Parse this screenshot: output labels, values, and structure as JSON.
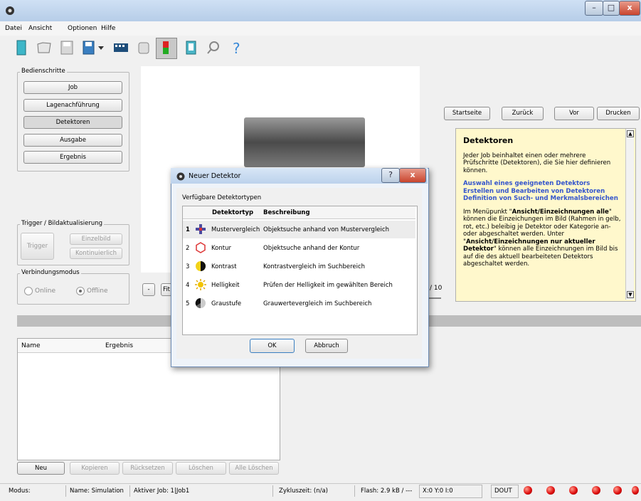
{
  "window": {
    "minimize": "–",
    "maximize": "□",
    "close": "x"
  },
  "menu": [
    "Datei",
    "Ansicht",
    "Optionen",
    "Hilfe"
  ],
  "steps": {
    "title": "Bedienschritte",
    "buttons": [
      "Job",
      "Lagenachführung",
      "Detektoren",
      "Ausgabe",
      "Ergebnis"
    ]
  },
  "trigger": {
    "title": "Trigger / Bildaktualisierung",
    "trigger_label": "Trigger",
    "single_label": "Einzelbild",
    "continuous_label": "Kontinuierlich"
  },
  "connection": {
    "title": "Verbindungsmodus",
    "online": "Online",
    "offline": "Offline"
  },
  "image_controls": {
    "minus": "-",
    "fit": "Fit",
    "page": "/ 10"
  },
  "results": {
    "col_name": "Name",
    "col_result": "Ergebnis",
    "buttons": [
      "Neu",
      "Kopieren",
      "Rücksetzen",
      "Löschen",
      "Alle Löschen"
    ]
  },
  "nav": [
    "Startseite",
    "Zurück",
    "Vor",
    "Drucken"
  ],
  "help": {
    "title": "Detektoren",
    "intro": "Jeder Job beinhaltet einen oder mehrere Prüfschritte (Detektoren), die Sie hier definieren können.",
    "links": [
      "Auswahl eines geeigneten Detektors",
      "Erstellen und Bearbeiten von Detektoren",
      "Definition von Such- und Merkmalsbereichen"
    ],
    "p1_a": "Im Menüpunkt \"",
    "p1_b": "Ansicht/Einzeichnungen alle",
    "p1_c": "\" können die Einzeichungen im Bild (Rahmen in gelb, rot, etc.) beleibig je Detektor oder Kategorie an- oder abgeschaltet werden. Unter \"",
    "p1_d": "Ansicht/Einzeichnungen nur aktueller Detektor",
    "p1_e": "\" können alle Einzeichnungen im Bild bis auf die des aktuell bearbeiteten Detektors abgeschaltet werden."
  },
  "dialog": {
    "title": "Neuer Detektor",
    "help_btn": "?",
    "close_btn": "x",
    "group_label": "Verfügbare Detektortypen",
    "col_type": "Detektortyp",
    "col_desc": "Beschreibung",
    "rows": [
      {
        "num": "1",
        "type": "Mustervergleich",
        "desc": "Objektsuche anhand von Mustervergleich",
        "icon": "cross-icon"
      },
      {
        "num": "2",
        "type": "Kontur",
        "desc": "Objektsuche anhand der Kontur",
        "icon": "hexagon-icon"
      },
      {
        "num": "3",
        "type": "Kontrast",
        "desc": "Kontrastvergleich im Suchbereich",
        "icon": "half-circle-icon"
      },
      {
        "num": "4",
        "type": "Helligkeit",
        "desc": "Prüfen der Helligkeit im gewählten Bereich",
        "icon": "sun-icon"
      },
      {
        "num": "5",
        "type": "Graustufe",
        "desc": "Grauwertevergleich im Suchbereich",
        "icon": "grayscale-icon"
      }
    ],
    "ok": "OK",
    "cancel": "Abbruch"
  },
  "status": {
    "mode": "Modus:",
    "name": "Name:  Simulation",
    "job": "Aktiver Job:  1|Job1",
    "cycle": "Zykluszeit:  (n/a)",
    "flash": "Flash:  2.9 kB / ---",
    "coords": "X:0 Y:0 I:0",
    "dout": "DOUT"
  },
  "colors": {
    "accent": "#3355cc",
    "led": "#e01010",
    "help_bg": "#fff8cc"
  }
}
